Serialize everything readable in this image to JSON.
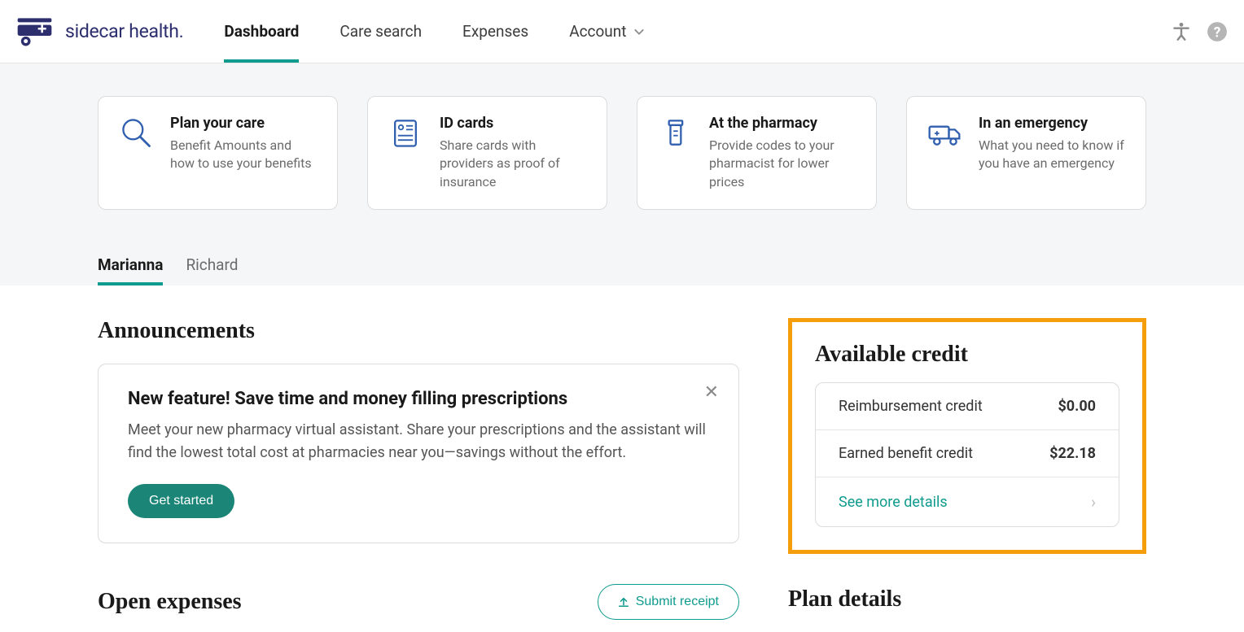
{
  "brand": "sidecar health.",
  "nav": {
    "dashboard": "Dashboard",
    "care_search": "Care search",
    "expenses": "Expenses",
    "account": "Account"
  },
  "cards": [
    {
      "title": "Plan your care",
      "desc": "Benefit Amounts and how to use your benefits"
    },
    {
      "title": "ID cards",
      "desc": "Share cards with providers as proof of insurance"
    },
    {
      "title": "At the pharmacy",
      "desc": "Provide codes to your pharmacist for lower prices"
    },
    {
      "title": "In an emergency",
      "desc": "What you need to know if you have an emergency"
    }
  ],
  "person_tabs": [
    "Marianna",
    "Richard"
  ],
  "announcements": {
    "heading": "Announcements",
    "item": {
      "title": "New feature! Save time and money filling prescriptions",
      "body": "Meet your new pharmacy virtual assistant. Share your prescriptions and the assistant will find the lowest total cost at pharmacies near you—savings without the effort.",
      "cta": "Get started"
    }
  },
  "open_expenses": {
    "heading": "Open expenses",
    "submit_label": "Submit receipt"
  },
  "available_credit": {
    "heading": "Available credit",
    "reimbursement_label": "Reimbursement credit",
    "reimbursement_value": "$0.00",
    "earned_label": "Earned benefit credit",
    "earned_value": "$22.18",
    "see_more": "See more details"
  },
  "plan_details": {
    "heading": "Plan details"
  }
}
